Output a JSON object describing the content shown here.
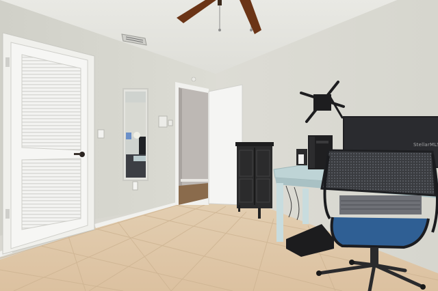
{
  "photo": {
    "subject": "home-office-bedroom",
    "watermark_text": "StellarMLS",
    "colors": {
      "wall": "#d9d9d1",
      "ceiling": "#e7e7e2",
      "floor_tile": "#dfc8a9",
      "trim": "#f2f2ef",
      "desk": "#bed4d6",
      "cabinet": "#2b2b2c",
      "fan_blade": "#6b3416",
      "chair_seat": "#2f5f94"
    }
  }
}
